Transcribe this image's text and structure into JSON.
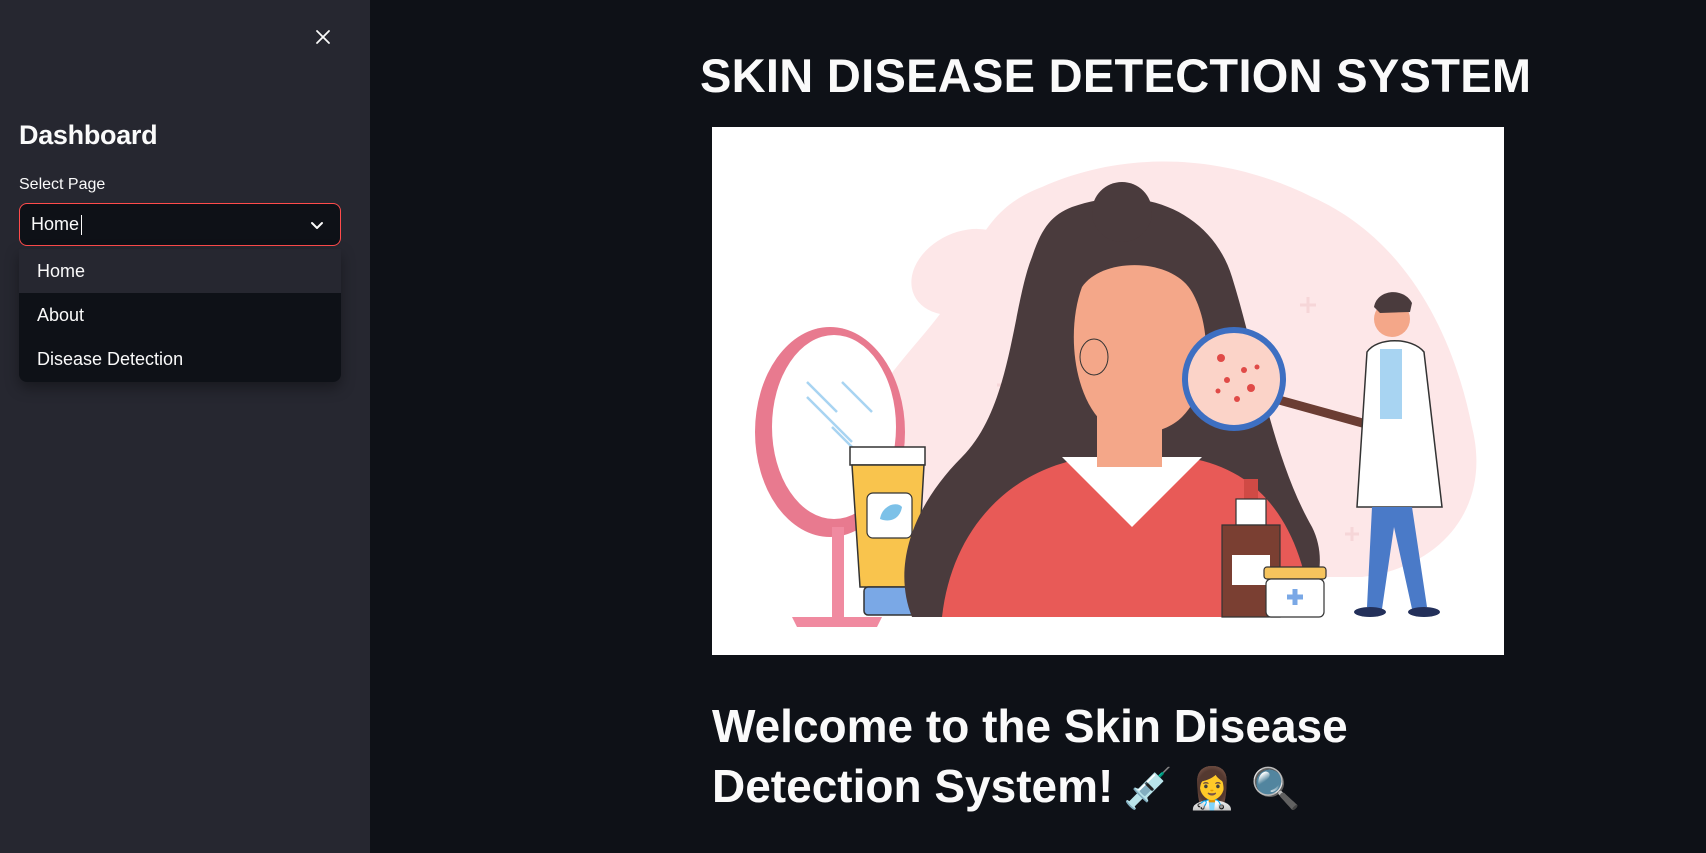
{
  "sidebar": {
    "title": "Dashboard",
    "select_label": "Select Page",
    "select_value": "Home",
    "options": [
      "Home",
      "About",
      "Disease Detection"
    ],
    "close_icon": "close-icon"
  },
  "main": {
    "title": "SKIN DISEASE DETECTION SYSTEM",
    "welcome": "Welcome to the Skin Disease Detection System!",
    "welcome_emojis": "💉 👩‍⚕️ 🔍",
    "hero_image": "woman-skin-examination-illustration"
  },
  "colors": {
    "accent": "#ff4b4b",
    "background": "#0e1117",
    "sidebar": "#262730"
  }
}
